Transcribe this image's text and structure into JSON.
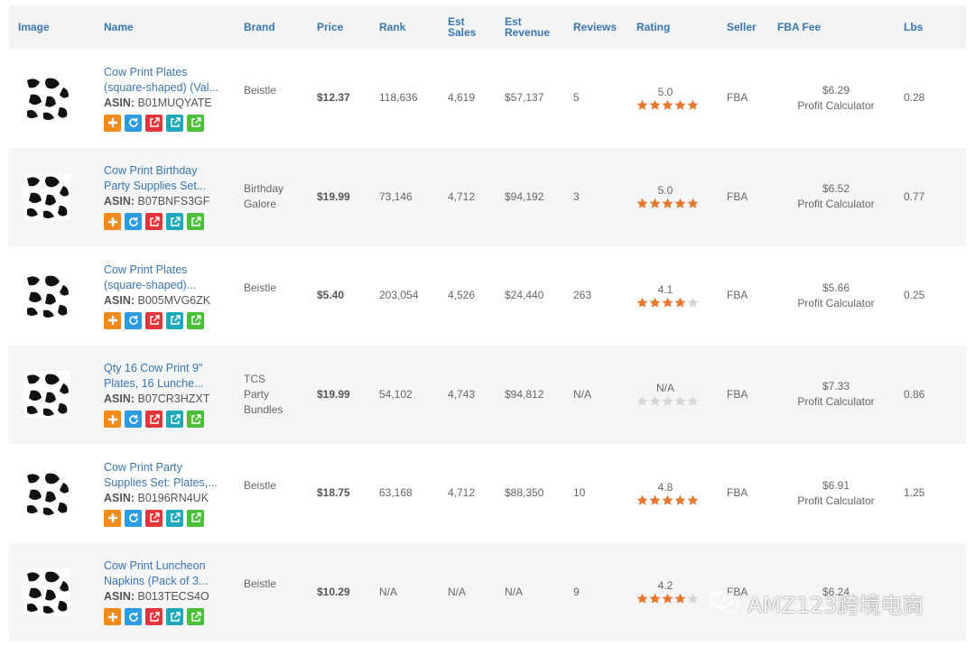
{
  "headers": {
    "image": "Image",
    "name": "Name",
    "brand": "Brand",
    "price": "Price",
    "rank": "Rank",
    "est_sales_1": "Est",
    "est_sales_2": "Sales",
    "est_revenue_1": "Est",
    "est_revenue_2": "Revenue",
    "reviews": "Reviews",
    "rating": "Rating",
    "seller": "Seller",
    "fba_fee": "FBA Fee",
    "lbs": "Lbs"
  },
  "asin_label": "ASIN:",
  "rows": [
    {
      "name_1": "Cow Print Plates",
      "name_2": "(square-shaped) (Val...",
      "asin": "B01MUQYATE",
      "brand_1": "Beistle",
      "brand_2": "",
      "brand_3": "",
      "price": "$12.37",
      "rank": "118,636",
      "sales": "4,619",
      "revenue": "$57,137",
      "reviews": "5",
      "rating_text": "5.0",
      "rating_value": 5.0,
      "seller": "FBA",
      "fee": "$6.29",
      "fee_link": "Profit Calculator",
      "lbs": "0.28"
    },
    {
      "name_1": "Cow Print Birthday",
      "name_2": "Party Supplies Set...",
      "asin": "B07BNFS3GF",
      "brand_1": "Birthday",
      "brand_2": "Galore",
      "brand_3": "",
      "price": "$19.99",
      "rank": "73,146",
      "sales": "4,712",
      "revenue": "$94,192",
      "reviews": "3",
      "rating_text": "5.0",
      "rating_value": 5.0,
      "seller": "FBA",
      "fee": "$6.52",
      "fee_link": "Profit Calculator",
      "lbs": "0.77"
    },
    {
      "name_1": "Cow Print Plates",
      "name_2": "(square-shaped)...",
      "asin": "B005MVG6ZK",
      "brand_1": "Beistle",
      "brand_2": "",
      "brand_3": "",
      "price": "$5.40",
      "rank": "203,054",
      "sales": "4,526",
      "revenue": "$24,440",
      "reviews": "263",
      "rating_text": "4.1",
      "rating_value": 4.1,
      "seller": "FBA",
      "fee": "$5.66",
      "fee_link": "Profit Calculator",
      "lbs": "0.25"
    },
    {
      "name_1": "Qty 16 Cow Print 9\"",
      "name_2": "Plates, 16 Lunche...",
      "asin": "B07CR3HZXT",
      "brand_1": "TCS",
      "brand_2": "Party",
      "brand_3": "Bundles",
      "price": "$19.99",
      "rank": "54,102",
      "sales": "4,743",
      "revenue": "$94,812",
      "reviews": "N/A",
      "rating_text": "N/A",
      "rating_value": 0,
      "seller": "FBA",
      "fee": "$7.33",
      "fee_link": "Profit Calculator",
      "lbs": "0.86"
    },
    {
      "name_1": "Cow Print Party",
      "name_2": "Supplies Set: Plates,...",
      "asin": "B0196RN4UK",
      "brand_1": "Beistle",
      "brand_2": "",
      "brand_3": "",
      "price": "$18.75",
      "rank": "63,168",
      "sales": "4,712",
      "revenue": "$88,350",
      "reviews": "10",
      "rating_text": "4.8",
      "rating_value": 4.8,
      "seller": "FBA",
      "fee": "$6.91",
      "fee_link": "Profit Calculator",
      "lbs": "1.25"
    },
    {
      "name_1": "Cow Print Luncheon",
      "name_2": "Napkins (Pack of 3...",
      "asin": "B013TECS4O",
      "brand_1": "Beistle",
      "brand_2": "",
      "brand_3": "",
      "price": "$10.29",
      "rank": "N/A",
      "sales": "N/A",
      "revenue": "N/A",
      "reviews": "9",
      "rating_text": "4.2",
      "rating_value": 4.2,
      "seller": "FBA",
      "fee": "$6.24",
      "fee_link": "",
      "lbs": ""
    }
  ],
  "watermark": "AMZ123跨境电商",
  "colors": {
    "header_text": "#3a76b0",
    "star_filled": "#e8772e",
    "star_empty": "#d6d6d6",
    "btn_add": "#f28b1a",
    "btn_refresh": "#2c9be0",
    "btn_link_red": "#e2353c",
    "btn_link_teal": "#1fa8b9",
    "btn_link_green": "#4bbf3a"
  },
  "icons": [
    "add-icon",
    "refresh-icon",
    "external-link-icon",
    "star-icon",
    "wechat-icon"
  ]
}
